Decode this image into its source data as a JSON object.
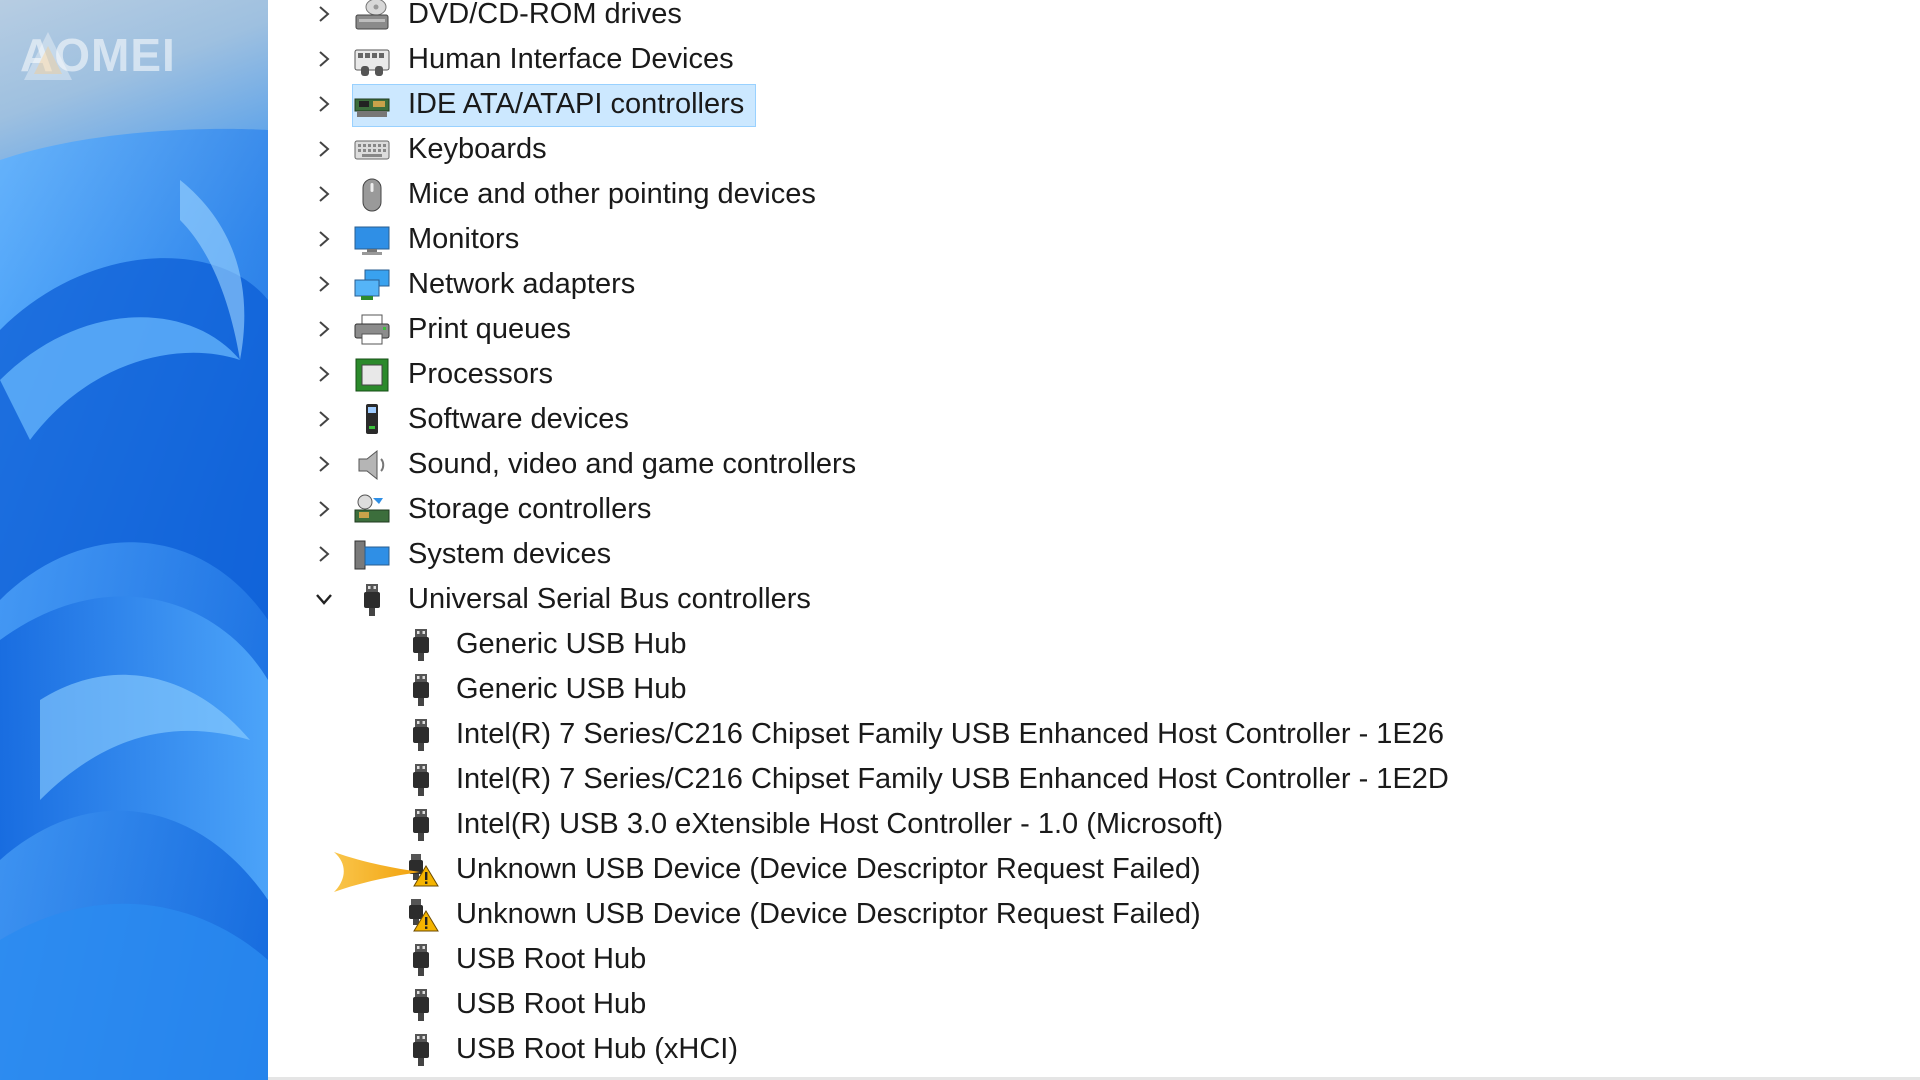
{
  "watermark": {
    "text": "AOMEI"
  },
  "colors": {
    "selection_bg": "#cce8ff",
    "selection_border": "#99d1ff",
    "warning": "#f5b400",
    "wallpaper_blue": "#1a73ea",
    "pointer_arrow": "#f7b52c"
  },
  "tree": {
    "categories": [
      {
        "label": "DVD/CD-ROM drives",
        "icon": "dvd-drive-icon",
        "expanded": false
      },
      {
        "label": "Human Interface Devices",
        "icon": "hid-icon",
        "expanded": false
      },
      {
        "label": "IDE ATA/ATAPI controllers",
        "icon": "ide-controller-icon",
        "expanded": false,
        "selected": true
      },
      {
        "label": "Keyboards",
        "icon": "keyboard-icon",
        "expanded": false
      },
      {
        "label": "Mice and other pointing devices",
        "icon": "mouse-icon",
        "expanded": false
      },
      {
        "label": "Monitors",
        "icon": "monitor-icon",
        "expanded": false
      },
      {
        "label": "Network adapters",
        "icon": "network-adapter-icon",
        "expanded": false
      },
      {
        "label": "Print queues",
        "icon": "printer-icon",
        "expanded": false
      },
      {
        "label": "Processors",
        "icon": "processor-icon",
        "expanded": false
      },
      {
        "label": "Software devices",
        "icon": "software-device-icon",
        "expanded": false
      },
      {
        "label": "Sound, video and game controllers",
        "icon": "speaker-icon",
        "expanded": false
      },
      {
        "label": "Storage controllers",
        "icon": "storage-controller-icon",
        "expanded": false
      },
      {
        "label": "System devices",
        "icon": "system-device-icon",
        "expanded": false
      },
      {
        "label": "Universal Serial Bus controllers",
        "icon": "usb-icon",
        "expanded": true
      }
    ],
    "usb_children": [
      {
        "label": "Generic USB Hub",
        "icon": "usb-icon",
        "warning": false
      },
      {
        "label": "Generic USB Hub",
        "icon": "usb-icon",
        "warning": false
      },
      {
        "label": "Intel(R) 7 Series/C216 Chipset Family USB Enhanced Host Controller - 1E26",
        "icon": "usb-icon",
        "warning": false
      },
      {
        "label": "Intel(R) 7 Series/C216 Chipset Family USB Enhanced Host Controller - 1E2D",
        "icon": "usb-icon",
        "warning": false
      },
      {
        "label": "Intel(R) USB 3.0 eXtensible Host Controller - 1.0 (Microsoft)",
        "icon": "usb-icon",
        "warning": false
      },
      {
        "label": "Unknown USB Device (Device Descriptor Request Failed)",
        "icon": "usb-warning-icon",
        "warning": true
      },
      {
        "label": "Unknown USB Device (Device Descriptor Request Failed)",
        "icon": "usb-warning-icon",
        "warning": true
      },
      {
        "label": "USB Root Hub",
        "icon": "usb-icon",
        "warning": false
      },
      {
        "label": "USB Root Hub",
        "icon": "usb-icon",
        "warning": false
      },
      {
        "label": "USB Root Hub (xHCI)",
        "icon": "usb-icon",
        "warning": false
      }
    ]
  }
}
